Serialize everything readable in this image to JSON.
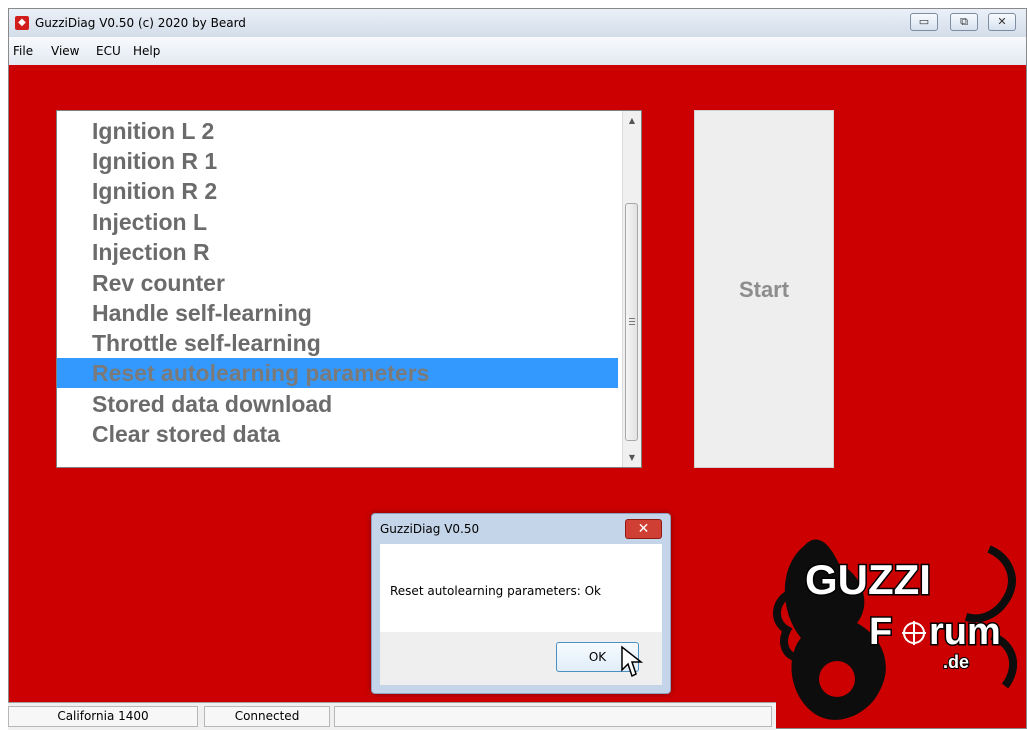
{
  "window": {
    "title": "GuzziDiag V0.50  (c) 2020 by Beard",
    "minimize_label": "▭",
    "maximize_label": "⧉",
    "close_label": "✕",
    "background_color": "#cc0000"
  },
  "menu": {
    "items": [
      {
        "label": "File"
      },
      {
        "label": "View"
      },
      {
        "label": "ECU"
      },
      {
        "label": "Help"
      }
    ]
  },
  "list": {
    "items": [
      {
        "label": "Ignition L 2"
      },
      {
        "label": "Ignition R 1"
      },
      {
        "label": "Ignition R 2"
      },
      {
        "label": "Injection L"
      },
      {
        "label": "Injection R"
      },
      {
        "label": "Rev counter"
      },
      {
        "label": "Handle self-learning"
      },
      {
        "label": "Throttle self-learning"
      },
      {
        "label": "Reset autolearning parameters",
        "selected": true
      },
      {
        "label": "Stored data download"
      },
      {
        "label": "Clear stored data"
      }
    ],
    "selection_color": "#3399ff"
  },
  "start_button": {
    "label": "Start"
  },
  "dialog": {
    "title": "GuzziDiag V0.50",
    "message": "Reset autolearning parameters: Ok",
    "ok_label": "OK",
    "close_label": "✕"
  },
  "status_bar": {
    "model": "California 1400",
    "connection": "Connected"
  },
  "logo": {
    "line1": "GUZZI",
    "line2a": "F",
    "line2b": "rum",
    "suffix": ".de"
  }
}
